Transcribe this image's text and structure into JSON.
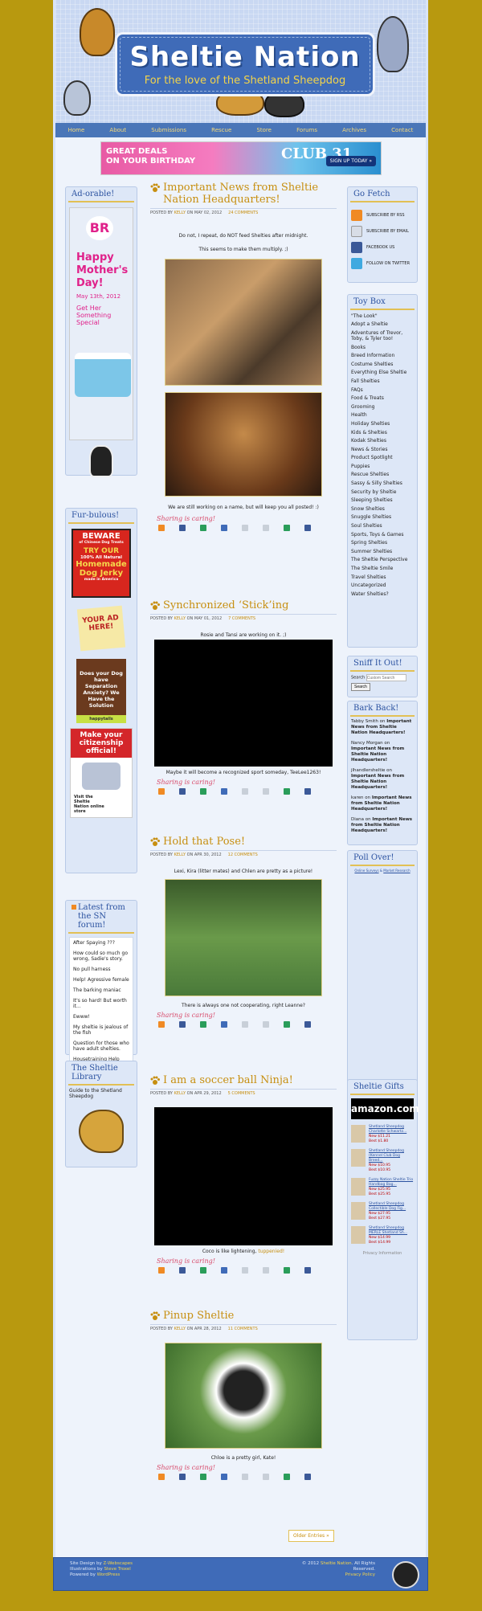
{
  "header": {
    "title": "Sheltie Nation",
    "subtitle": "For the love of the Shetland Sheepdog"
  },
  "nav": [
    "Home",
    "About",
    "Submissions",
    "Rescue",
    "Store",
    "Forums",
    "Archives",
    "Contact"
  ],
  "banner": {
    "line1": "GREAT DEALS",
    "line2": "ON YOUR BIRTHDAY",
    "club": "CLUB 31",
    "cta": "SIGN UP TODAY »"
  },
  "left": {
    "adorable": {
      "heading": "Ad-orable!",
      "ad_brand": "BR",
      "ad_lines": [
        "Happy",
        "Mother's",
        "Day!"
      ],
      "ad_date": "May 13th, 2012",
      "ad_sub": "Get Her Something Special"
    },
    "furbulous": {
      "heading": "Fur-bulous!",
      "jerky": {
        "beware": "BEWARE",
        "beware_sub": "of Chinese Dog Treats",
        "try": "TRY OUR",
        "natural": "100% All Natural",
        "main": "Homemade Dog Jerky",
        "foot": "made in America"
      },
      "note": "YOUR AD HERE!",
      "anxiety": "Does your Dog have Separation Anxiety? We Have the Solution",
      "anxiety_brand": "happytails",
      "citizenship": "Make your citizenship official!",
      "store": "Visit the Sheltie Nation online store"
    },
    "forum": {
      "heading": "Latest from the SN forum!",
      "items": [
        "After Spaying ???",
        "How could so much go wrong, Sadie's story.",
        "No pull harness",
        "Help! Agressive female",
        "The barking maniac",
        "It's so hard! But worth it...",
        "Ewww!",
        "My sheltie is jealous of the fish",
        "Question for those who have adult shelties.",
        "Housetraining Help"
      ]
    },
    "library": {
      "heading": "The Sheltie Library",
      "items": [
        "Guide to the Shetland Sheepdog"
      ]
    }
  },
  "posts": [
    {
      "title": "Important News from Sheltie Nation Headquarters!",
      "by": "KELLY",
      "date": "MAY 02, 2012",
      "comments": "24 COMMENTS",
      "text1": "Do not, I repeat, do NOT feed Shelties after midnight.",
      "text2": "This seems to make them multiply. ;)",
      "text3": "We are still working on a name, but will keep you all posted! :)"
    },
    {
      "title": "Synchronized ‘Stick’ing",
      "by": "KELLY",
      "date": "MAY 01, 2012",
      "comments": "7 COMMENTS",
      "text1": "Rosie and Tansi are working on it. ;)",
      "text2": "Maybe it will become a recognized sport someday, TeeLee1263!"
    },
    {
      "title": "Hold that Pose!",
      "by": "KELLY",
      "date": "APR 30, 2012",
      "comments": "12 COMMENTS",
      "text1": "Lexi, Kira (litter mates) and Chlen are pretty as a picture!",
      "text2": "There is always one not cooperating, right Leanne?"
    },
    {
      "title": "I am a soccer ball Ninja!",
      "by": "KELLY",
      "date": "APR 29, 2012",
      "comments": "5 COMMENTS",
      "text1": "Coco is like lightening,",
      "text1_link": "tuppenied!"
    },
    {
      "title": "Pinup Sheltie",
      "by": "KELLY",
      "date": "APR 28, 2012",
      "comments": "11 COMMENTS",
      "text1": "Chloe is a pretty girl, Kate!"
    }
  ],
  "meta": {
    "posted_by": "POSTED BY",
    "on": "ON",
    "sharing": "Sharing is caring!"
  },
  "right": {
    "gofetch": {
      "heading": "Go Fetch",
      "items": [
        "SUBSCRIBE BY RSS",
        "SUBSCRIBE BY EMAIL",
        "FACEBOOK US",
        "FOLLOW ON TWITTER"
      ]
    },
    "toybox": {
      "heading": "Toy Box",
      "items": [
        "\"The Look\"",
        "Adopt a Sheltie",
        "Adventures of Trevor, Toby, & Tyler too!",
        "Books",
        "Breed Information",
        "Costume Shelties",
        "Everything Else Sheltie",
        "Fall Shelties",
        "FAQs",
        "Food & Treats",
        "Grooming",
        "Health",
        "Holiday Shelties",
        "Kids & Shelties",
        "Kodak Shelties",
        "News & Stories",
        "Product Spotlight",
        "Puppies",
        "Rescue Shelties",
        "Sassy & Silly Shelties",
        "Security by Sheltie",
        "Sleeping Shelties",
        "Snow Shelties",
        "Snuggle Shelties",
        "Soul Shelties",
        "Sports, Toys & Games",
        "Spring Shelties",
        "Summer Shelties",
        "The Sheltie Perspective",
        "The Sheltie Smile",
        "Travel Shelties",
        "Uncategorized",
        "Water Shelties?"
      ]
    },
    "sniff": {
      "heading": "Sniff It Out!",
      "search_label": "Search",
      "placeholder": "Custom Search",
      "button": "Search"
    },
    "barkback": {
      "heading": "Bark Back!",
      "items": [
        {
          "who": "Tabby Smith",
          "on": "on",
          "what": "Important News from Sheltie Nation Headquarters!"
        },
        {
          "who": "Nancy Morgan",
          "on": "on",
          "what": "Important News from Sheltie Nation Headquarters!"
        },
        {
          "who": "jlhandlersheltie",
          "on": "on",
          "what": "Important News from Sheltie Nation Headquarters!"
        },
        {
          "who": "karen",
          "on": "on",
          "what": "Important News from Sheltie Nation Headquarters!"
        },
        {
          "who": "Diana",
          "on": "on",
          "what": "Important News from Sheltie Nation Headquarters!"
        }
      ]
    },
    "poll": {
      "heading": "Poll Over!",
      "links": [
        "Online Surveys",
        "Market Research"
      ]
    },
    "gifts": {
      "heading": "Sheltie Gifts",
      "amazon": "amazon.com",
      "items": [
        {
          "name": "Shetland Sheepdog Charlotte Schwartz...",
          "new": "New $11.21",
          "best": "Best $1.80"
        },
        {
          "name": "Shetland Sheepdog (Kennel Club Dog Breed...",
          "new": "New $10.95",
          "best": "Best $10.95"
        },
        {
          "name": "Fuzzy Nation Sheltie Trio Handbag Bag...",
          "new": "New $25.95",
          "best": "Best $25.95"
        },
        {
          "name": "Shetland Sheepdog Collectible Dog Fig...",
          "new": "New $27.95",
          "best": "Best $27.95"
        },
        {
          "name": "Shetland Sheepdog MERLE Shetland Sh...",
          "new": "New $14.99",
          "best": "Best $14.99"
        }
      ],
      "privacy": "Privacy Information"
    }
  },
  "older": "Older Entries »",
  "footer": {
    "line1": "Site Design by",
    "designer": "Z-Webscapes",
    "line2": "Illustrations by",
    "illustrator": "Steve Troxel",
    "line3": "Powered by",
    "powered": "WordPress",
    "copy": "© 2012",
    "site": "Sheltie Nation",
    "rights": ". All Rights Reserved.",
    "privacy": "Privacy Policy"
  },
  "colors": {
    "background": "#b8990f",
    "nav": "#4a76b8",
    "accent": "#c78f10",
    "link_blue": "#2b52a0"
  }
}
